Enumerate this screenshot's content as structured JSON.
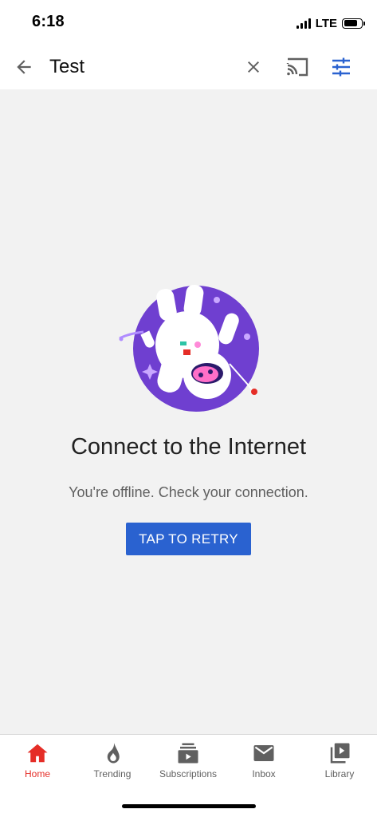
{
  "status_bar": {
    "time": "6:18",
    "network": "LTE"
  },
  "search": {
    "query": "Test",
    "icons": [
      "back-arrow-icon",
      "close-icon",
      "cast-icon",
      "filter-icon"
    ]
  },
  "error": {
    "title": "Connect to the Internet",
    "subtitle": "You're offline. Check your connection.",
    "retry_label": "TAP TO RETRY"
  },
  "nav": {
    "items": [
      {
        "label": "Home",
        "icon": "home-icon",
        "active": true
      },
      {
        "label": "Trending",
        "icon": "flame-icon",
        "active": false
      },
      {
        "label": "Subscriptions",
        "icon": "subscriptions-icon",
        "active": false
      },
      {
        "label": "Inbox",
        "icon": "mail-icon",
        "active": false
      },
      {
        "label": "Library",
        "icon": "library-icon",
        "active": false
      }
    ]
  },
  "colors": {
    "accent": "#2a62d0",
    "active_nav": "#e52d27",
    "illustration_purple": "#6f3fd0",
    "background": "#f2f2f2"
  }
}
